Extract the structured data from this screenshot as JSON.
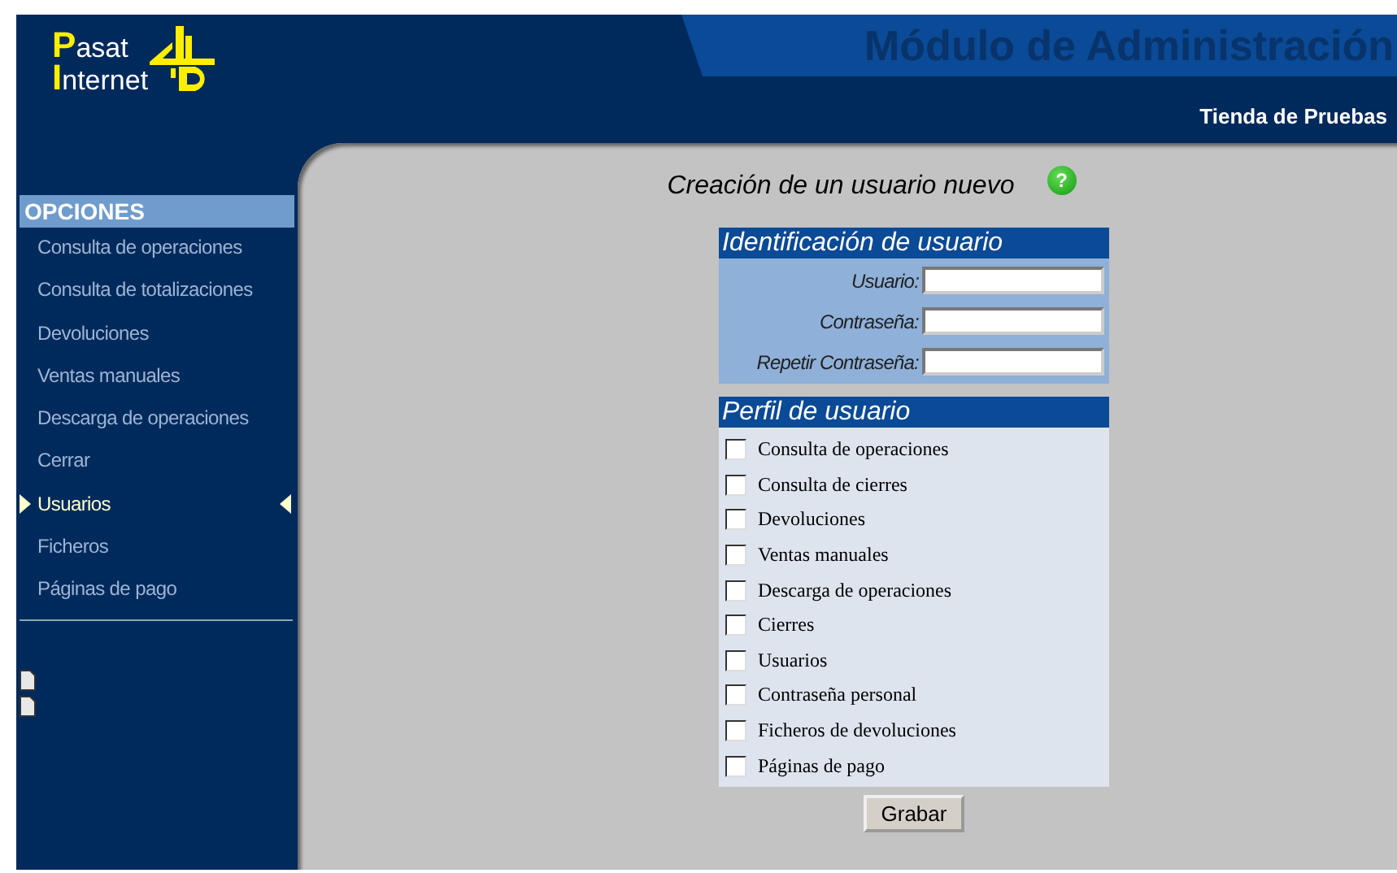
{
  "header": {
    "logo": {
      "line_1": "Pasat",
      "line_2": "Internet"
    },
    "title": "Módulo de Administración",
    "store": "Tienda de Pruebas"
  },
  "sidebar": {
    "heading": "OPCIONES",
    "items": [
      {
        "label": "Consulta de operaciones",
        "selected": false
      },
      {
        "label": "Consulta de totalizaciones",
        "selected": false
      },
      {
        "label": "Devoluciones",
        "selected": false
      },
      {
        "label": "Ventas manuales",
        "selected": false
      },
      {
        "label": "Descarga de operaciones",
        "selected": false
      },
      {
        "label": "Cerrar",
        "selected": false
      },
      {
        "label": "Usuarios",
        "selected": true
      },
      {
        "label": "Ficheros",
        "selected": false
      },
      {
        "label": "Páginas de pago",
        "selected": false
      }
    ]
  },
  "page": {
    "title": "Creación de un usuario nuevo",
    "help_button": "?",
    "identification": {
      "heading": "Identificación de usuario",
      "fields": [
        {
          "label": "Usuario:"
        },
        {
          "label": "Contraseña:"
        },
        {
          "label": "Repetir Contraseña:"
        }
      ]
    },
    "profile": {
      "heading": "Perfil de usuario",
      "permissions": [
        {
          "label": "Consulta de operaciones",
          "checked": false
        },
        {
          "label": "Consulta de cierres",
          "checked": false
        },
        {
          "label": "Devoluciones",
          "checked": false
        },
        {
          "label": "Ventas manuales",
          "checked": false
        },
        {
          "label": "Descarga de operaciones",
          "checked": false
        },
        {
          "label": "Cierres",
          "checked": false
        },
        {
          "label": "Usuarios",
          "checked": false
        },
        {
          "label": "Contraseña personal",
          "checked": false
        },
        {
          "label": "Ficheros de devoluciones",
          "checked": false
        },
        {
          "label": "Páginas de pago",
          "checked": false
        }
      ]
    },
    "save_button": "Grabar"
  }
}
